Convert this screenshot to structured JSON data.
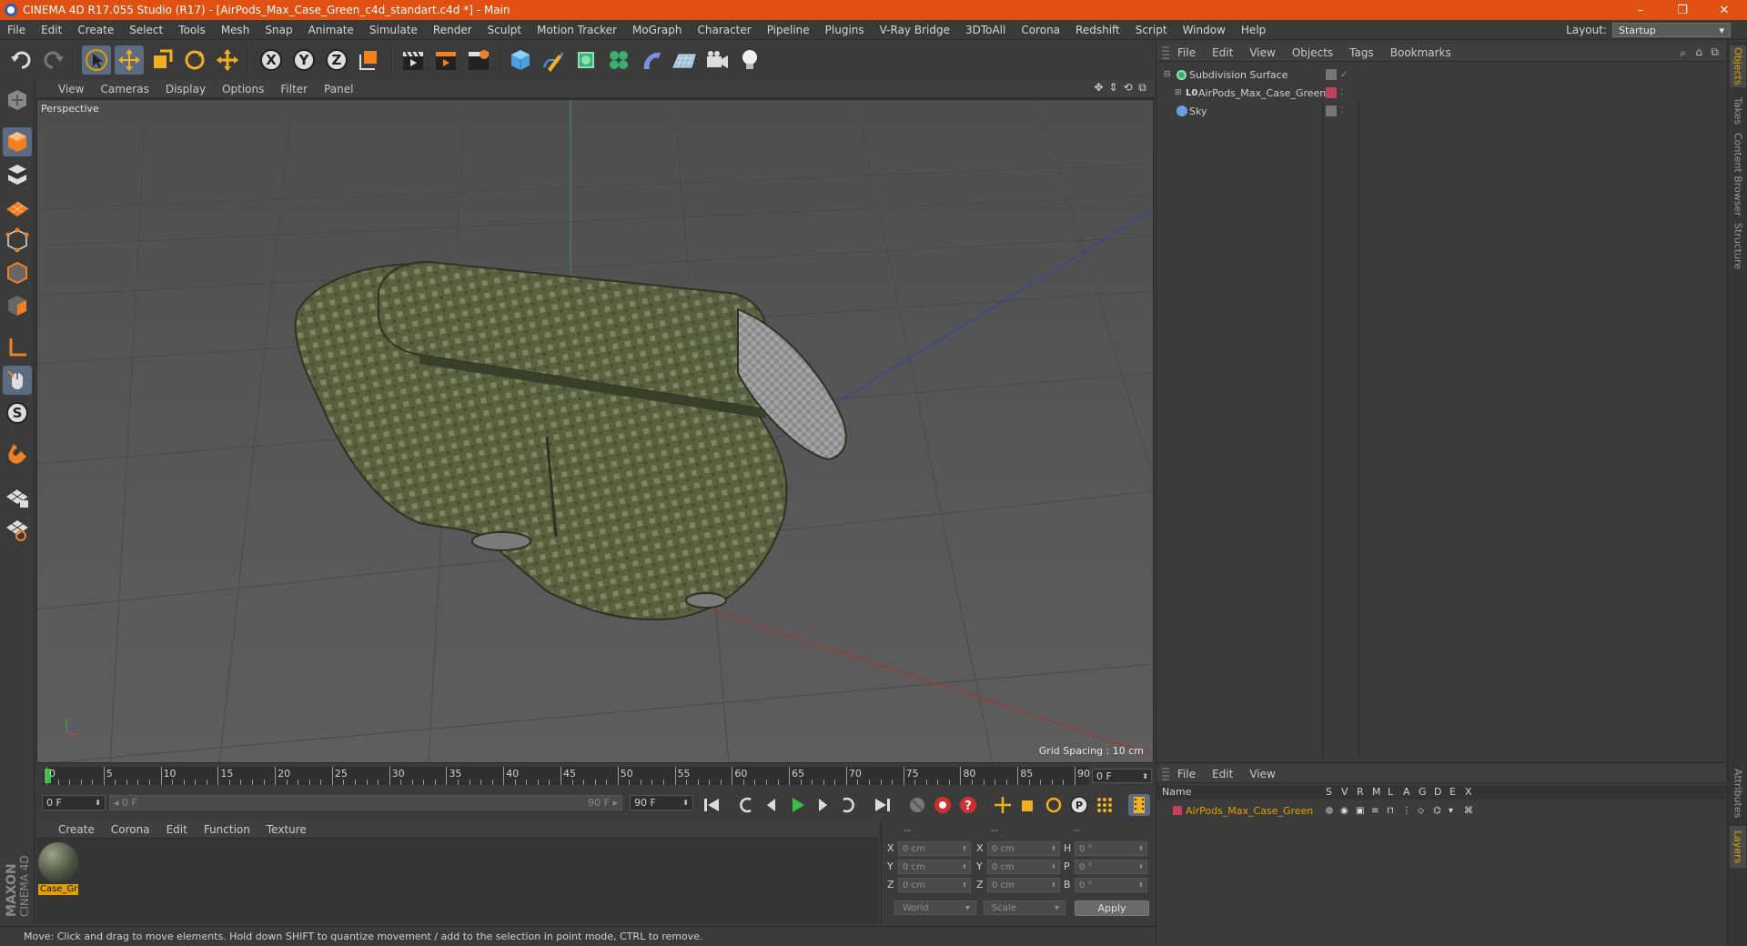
{
  "window": {
    "title": "CINEMA 4D R17.055 Studio (R17) - [AirPods_Max_Case_Green_c4d_standart.c4d *] - Main",
    "minimize": "–",
    "restore": "❐",
    "close": "✕"
  },
  "menubar": {
    "items": [
      "File",
      "Edit",
      "Create",
      "Select",
      "Tools",
      "Mesh",
      "Snap",
      "Animate",
      "Simulate",
      "Render",
      "Sculpt",
      "Motion Tracker",
      "MoGraph",
      "Character",
      "Pipeline",
      "Plugins",
      "V-Ray Bridge",
      "3DToAll",
      "Corona",
      "Redshift",
      "Script",
      "Window",
      "Help"
    ],
    "layout_label": "Layout:",
    "layout_value": "Startup"
  },
  "viewport": {
    "menu": [
      "View",
      "Cameras",
      "Display",
      "Options",
      "Filter",
      "Panel"
    ],
    "label": "Perspective",
    "grid_spacing": "Grid Spacing : 10 cm",
    "nav_icons": [
      "✥",
      "⇕",
      "⟲",
      "⧉"
    ]
  },
  "timeline": {
    "ticks": [
      "0",
      "5",
      "10",
      "15",
      "20",
      "25",
      "30",
      "35",
      "40",
      "45",
      "50",
      "55",
      "60",
      "65",
      "70",
      "75",
      "80",
      "85",
      "90"
    ],
    "current_frame": "0 F",
    "start_field": "0 F",
    "range_start": "◂ 0 F",
    "range_end": "90 F ▸",
    "end_field": "90 F"
  },
  "material_manager": {
    "menu": [
      "Create",
      "Corona",
      "Edit",
      "Function",
      "Texture"
    ],
    "material_name": "Case_Gr"
  },
  "coordinates": {
    "headers": [
      "--",
      "--",
      "--"
    ],
    "rows": [
      {
        "a": "X",
        "av": "0 cm",
        "b": "X",
        "bv": "0 cm",
        "c": "H",
        "cv": "0 °"
      },
      {
        "a": "Y",
        "av": "0 cm",
        "b": "Y",
        "bv": "0 cm",
        "c": "P",
        "cv": "0 °"
      },
      {
        "a": "Z",
        "av": "0 cm",
        "b": "Z",
        "bv": "0 cm",
        "c": "B",
        "cv": "0 °"
      }
    ],
    "world": "World",
    "scale": "Scale",
    "apply": "Apply"
  },
  "statusbar": "Move: Click and drag to move elements. Hold down SHIFT to quantize movement / add to the selection in point mode, CTRL to remove.",
  "object_manager": {
    "menu": [
      "File",
      "Edit",
      "View",
      "Objects",
      "Tags",
      "Bookmarks"
    ],
    "objects": [
      {
        "name": "Subdivision Surface",
        "icon": "subdivision-icon"
      },
      {
        "name": "AirPods_Max_Case_Green",
        "icon": "null-object-icon"
      },
      {
        "name": "Sky",
        "icon": "sky-icon"
      }
    ]
  },
  "layer_manager": {
    "menu": [
      "File",
      "Edit",
      "View"
    ],
    "columns": [
      "Name",
      "S",
      "V",
      "R",
      "M",
      "L",
      "A",
      "G",
      "D",
      "E",
      "X"
    ],
    "layers": [
      {
        "name": "AirPods_Max_Case_Green",
        "color": "#c04060"
      }
    ]
  },
  "side_tabs": [
    "Objects",
    "Takes",
    "Content Browser",
    "Structure",
    "Attributes",
    "Layers"
  ],
  "colors": {
    "title_bar": "#e05012",
    "accent": "#e0a000",
    "active_tool": "#5a6b82"
  }
}
